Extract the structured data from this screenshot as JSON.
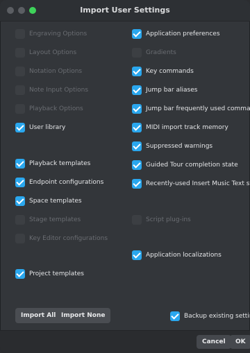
{
  "window": {
    "title": "Import User Settings"
  },
  "left_items": [
    {
      "label": "Engraving Options",
      "checked": false,
      "enabled": false
    },
    {
      "label": "Layout Options",
      "checked": false,
      "enabled": false
    },
    {
      "label": "Notation Options",
      "checked": false,
      "enabled": false
    },
    {
      "label": "Note Input Options",
      "checked": false,
      "enabled": false
    },
    {
      "label": "Playback Options",
      "checked": false,
      "enabled": false
    },
    {
      "label": "User library",
      "checked": true,
      "enabled": true
    },
    {
      "label": "Playback templates",
      "checked": true,
      "enabled": true
    },
    {
      "label": "Endpoint configurations",
      "checked": true,
      "enabled": true
    },
    {
      "label": "Space templates",
      "checked": true,
      "enabled": true
    },
    {
      "label": "Stage templates",
      "checked": false,
      "enabled": false
    },
    {
      "label": "Key Editor configurations",
      "checked": false,
      "enabled": false
    },
    {
      "label": "Project templates",
      "checked": true,
      "enabled": true
    }
  ],
  "right_items": [
    {
      "label": "Application preferences",
      "checked": true,
      "enabled": true
    },
    {
      "label": "Gradients",
      "checked": false,
      "enabled": false
    },
    {
      "label": "Key commands",
      "checked": true,
      "enabled": true
    },
    {
      "label": "Jump bar aliases",
      "checked": true,
      "enabled": true
    },
    {
      "label": "Jump bar frequently used commands",
      "checked": true,
      "enabled": true
    },
    {
      "label": "MIDI import track memory",
      "checked": true,
      "enabled": true
    },
    {
      "label": "Suppressed warnings",
      "checked": true,
      "enabled": true
    },
    {
      "label": "Guided Tour completion state",
      "checked": true,
      "enabled": true
    },
    {
      "label": "Recently-used Insert Music Text symbols",
      "checked": true,
      "enabled": true
    },
    {
      "label": "Script plug-ins",
      "checked": false,
      "enabled": false
    },
    {
      "label": "Application localizations",
      "checked": true,
      "enabled": true
    }
  ],
  "buttons": {
    "import_all": "Import All",
    "import_none": "Import None",
    "cancel": "Cancel",
    "ok": "OK"
  },
  "backup": {
    "label": "Backup existing settings",
    "checked": true
  },
  "colors": {
    "accent": "#2aa7ee",
    "traffic_green": "#3ed35a"
  }
}
